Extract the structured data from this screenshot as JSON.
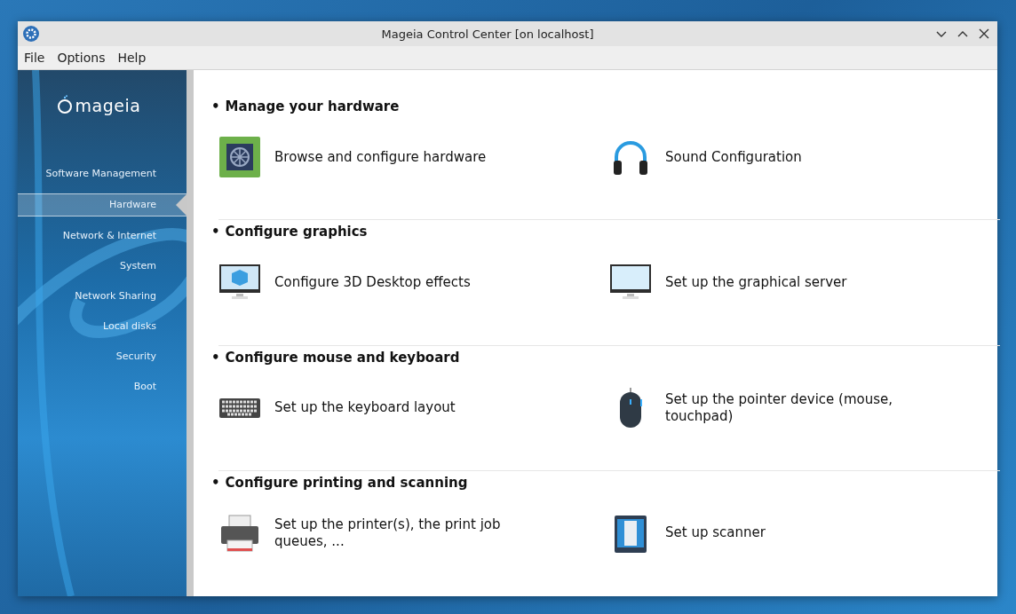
{
  "window": {
    "title": "Mageia Control Center [on localhost]"
  },
  "menu": [
    "File",
    "Options",
    "Help"
  ],
  "sidebar": {
    "logo_text": "mageia",
    "items": [
      {
        "label": "Software Management",
        "selected": false
      },
      {
        "label": "Hardware",
        "selected": true
      },
      {
        "label": "Network & Internet",
        "selected": false
      },
      {
        "label": "System",
        "selected": false
      },
      {
        "label": "Network Sharing",
        "selected": false
      },
      {
        "label": "Local disks",
        "selected": false
      },
      {
        "label": "Security",
        "selected": false
      },
      {
        "label": "Boot",
        "selected": false
      }
    ]
  },
  "sections": [
    {
      "bullet": "•",
      "title": "Manage your hardware",
      "items": [
        {
          "kind": "hardware",
          "label": "Browse and configure hardware"
        },
        {
          "kind": "sound",
          "label": "Sound Configuration"
        }
      ]
    },
    {
      "bullet": "•",
      "title": "Configure graphics",
      "items": [
        {
          "kind": "display3d",
          "label": "Configure 3D Desktop effects"
        },
        {
          "kind": "monitor",
          "label": "Set up the graphical server"
        }
      ]
    },
    {
      "bullet": "•",
      "title": "Configure mouse and keyboard",
      "items": [
        {
          "kind": "keyboard",
          "label": "Set up the keyboard layout"
        },
        {
          "kind": "mouse",
          "label": "Set up the pointer device (mouse, touchpad)"
        }
      ]
    },
    {
      "bullet": "•",
      "title": "Configure printing and scanning",
      "items": [
        {
          "kind": "printer",
          "label": "Set up the printer(s), the print job queues, ..."
        },
        {
          "kind": "scanner",
          "label": "Set up scanner"
        }
      ]
    }
  ]
}
